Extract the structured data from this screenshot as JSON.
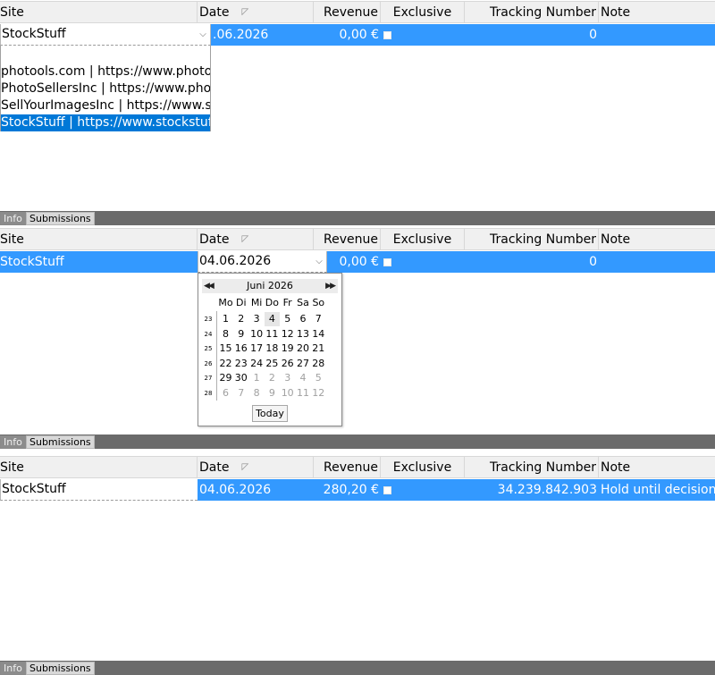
{
  "columns": {
    "site": "Site",
    "date": "Date",
    "revenue": "Revenue",
    "exclusive": "Exclusive",
    "tracking": "Tracking Number",
    "note": "Note"
  },
  "tabs": {
    "info": "Info",
    "submissions": "Submissions"
  },
  "panel1": {
    "site_value": "StockStuff",
    "date_partial": ".06.2026",
    "revenue": "0,00 €",
    "tracking": "0",
    "dropdown_options": [
      "photools.com | https://www.photools.com",
      "PhotoSellersInc | https://www.photosellersinc.com",
      "SellYourImagesInc | https://www.sellyourimagesinc.com",
      "StockStuff | https://www.stockstuff.com"
    ],
    "selected_option_index": 3
  },
  "panel2": {
    "site_value": "StockStuff",
    "date_value": "04.06.2026",
    "revenue": "0,00 €",
    "tracking": "0",
    "calendar": {
      "month_label": "Juni 2026",
      "weekdays": [
        "Mo",
        "Di",
        "Mi",
        "Do",
        "Fr",
        "Sa",
        "So"
      ],
      "weeks": [
        {
          "num": "23",
          "days": [
            "1",
            "2",
            "3",
            "4",
            "5",
            "6",
            "7"
          ]
        },
        {
          "num": "24",
          "days": [
            "8",
            "9",
            "10",
            "11",
            "12",
            "13",
            "14"
          ]
        },
        {
          "num": "25",
          "days": [
            "15",
            "16",
            "17",
            "18",
            "19",
            "20",
            "21"
          ]
        },
        {
          "num": "26",
          "days": [
            "22",
            "23",
            "24",
            "25",
            "26",
            "27",
            "28"
          ]
        },
        {
          "num": "27",
          "days": [
            "29",
            "30",
            "1",
            "2",
            "3",
            "4",
            "5"
          ]
        },
        {
          "num": "28",
          "days": [
            "6",
            "7",
            "8",
            "9",
            "10",
            "11",
            "12"
          ]
        }
      ],
      "today_day": "4",
      "today_button": "Today"
    }
  },
  "panel3": {
    "site_value": "StockStuff",
    "date_value": "04.06.2026",
    "revenue": "280,20 €",
    "tracking": "34.239.842.903",
    "note": "Hold until decision a"
  },
  "colors": {
    "selection": "#3399ff",
    "list_selection": "#0078d7",
    "tabbar": "#6b6b6b"
  }
}
